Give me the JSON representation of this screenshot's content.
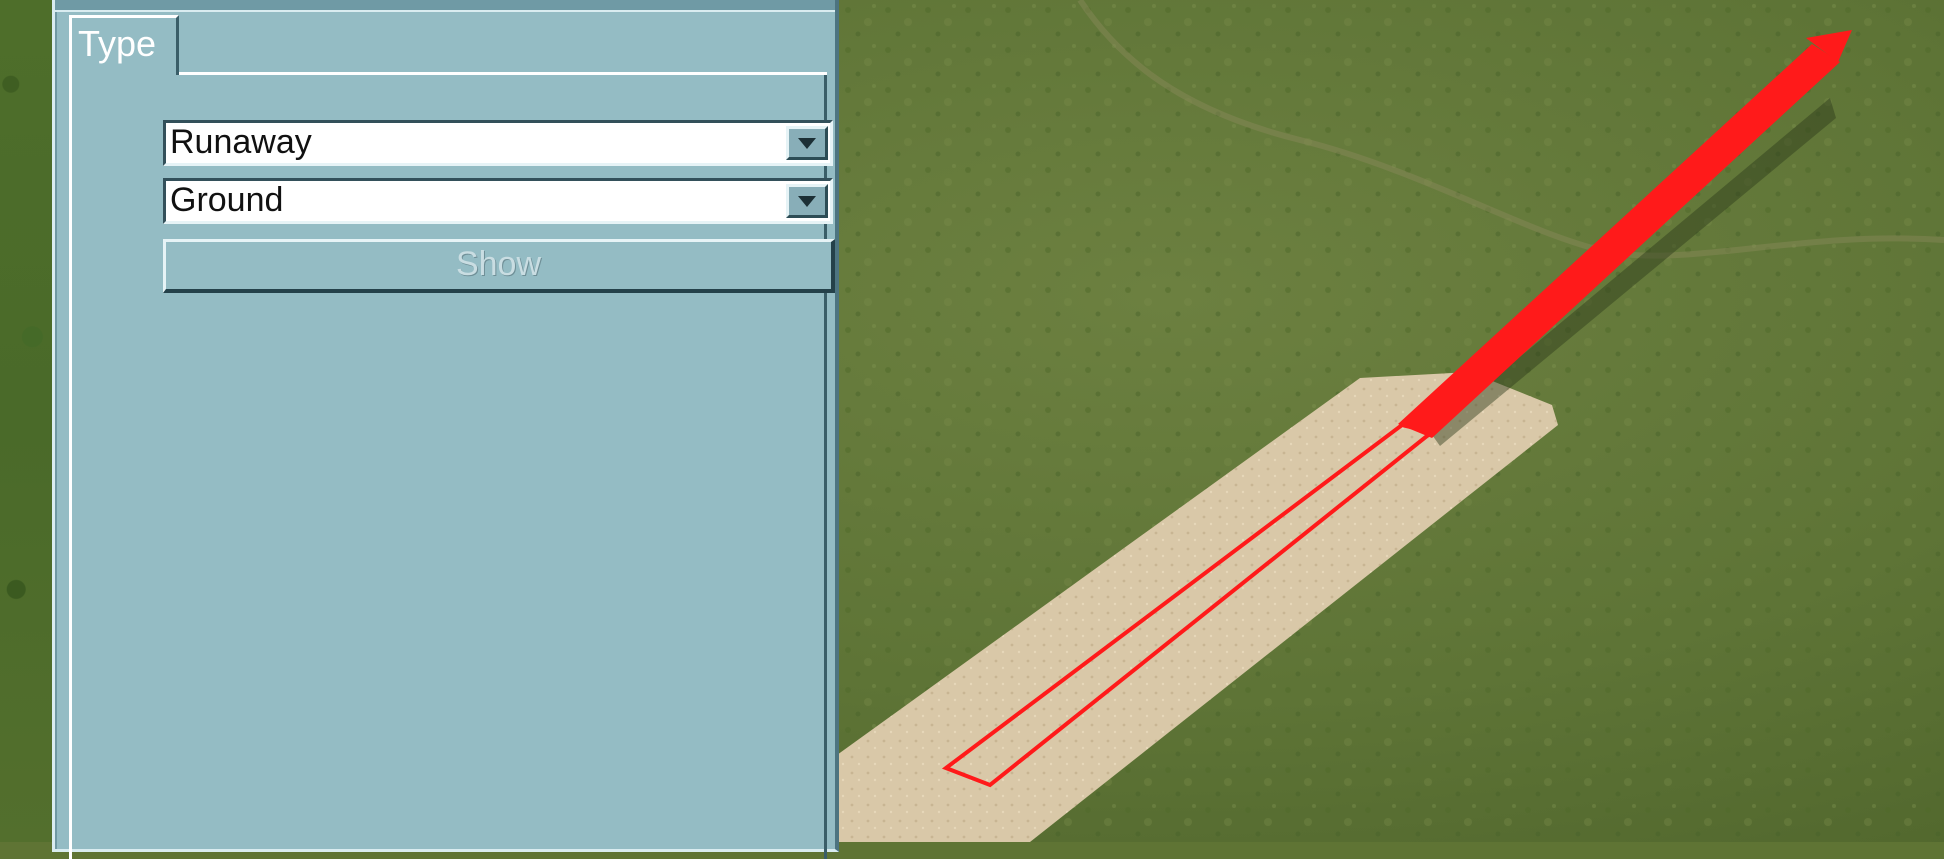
{
  "panel": {
    "tab_label": "Type",
    "type_select": {
      "value": "Runaway"
    },
    "surface_select": {
      "value": "Ground"
    },
    "show_button_label": "Show",
    "show_button_enabled": false
  },
  "viewport": {
    "grass_color": "#5f7434",
    "runway_color": "#d9c8a8",
    "marker_color": "#ff1a1a"
  }
}
